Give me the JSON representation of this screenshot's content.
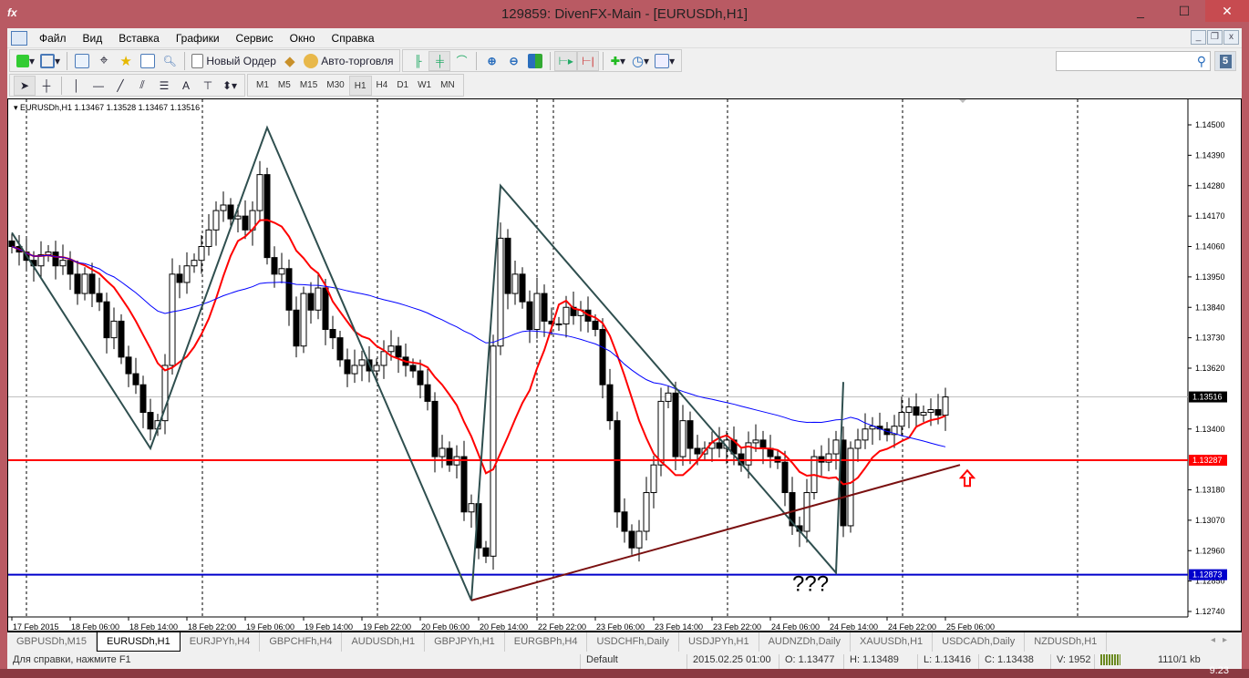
{
  "window": {
    "title": "129859: DivenFX-Main - [EURUSDh,H1]",
    "minimize": "_",
    "maximize": "☐",
    "close": "✕"
  },
  "menu": [
    "Файл",
    "Вид",
    "Вставка",
    "Графики",
    "Сервис",
    "Окно",
    "Справка"
  ],
  "toolbar": {
    "new_order": "Новый Ордер",
    "auto_trading": "Авто-торговля",
    "search_placeholder": "",
    "notifications": "5"
  },
  "drawing_tools": {
    "text_tool": "A"
  },
  "timeframes": [
    "M1",
    "M5",
    "M15",
    "M30",
    "H1",
    "H4",
    "D1",
    "W1",
    "MN"
  ],
  "active_timeframe": "H1",
  "chart_data": {
    "type": "candlestick",
    "legend": "EURUSDh,H1  1.13467 1.13528 1.13467 1.13516",
    "symbol": "EURUSDh",
    "timeframe": "H1",
    "ylim": [
      1.1268,
      1.1458
    ],
    "y_ticks": [
      "1.14500",
      "1.14390",
      "1.14280",
      "1.14170",
      "1.14060",
      "1.13950",
      "1.13840",
      "1.13730",
      "1.13620",
      "1.13400",
      "1.13180",
      "1.13070",
      "1.12960",
      "1.12850",
      "1.12740"
    ],
    "x_ticks": [
      "17 Feb 2015",
      "18 Feb 06:00",
      "18 Feb 14:00",
      "18 Feb 22:00",
      "19 Feb 06:00",
      "19 Feb 14:00",
      "19 Feb 22:00",
      "20 Feb 06:00",
      "20 Feb 14:00",
      "22 Feb 22:00",
      "23 Feb 06:00",
      "23 Feb 14:00",
      "23 Feb 22:00",
      "24 Feb 06:00",
      "24 Feb 14:00",
      "24 Feb 22:00",
      "25 Feb 06:00"
    ],
    "closes": [
      1.1406,
      1.1404,
      1.1401,
      1.1399,
      1.1403,
      1.1404,
      1.1399,
      1.1401,
      1.1396,
      1.1389,
      1.1396,
      1.1389,
      1.1386,
      1.1373,
      1.1379,
      1.1366,
      1.136,
      1.1356,
      1.1346,
      1.134,
      1.1343,
      1.1363,
      1.1396,
      1.1393,
      1.1399,
      1.1401,
      1.1406,
      1.1412,
      1.1419,
      1.1421,
      1.1416,
      1.1417,
      1.1412,
      1.1419,
      1.1432,
      1.1402,
      1.1396,
      1.1398,
      1.1383,
      1.137,
      1.1389,
      1.1383,
      1.1391,
      1.1376,
      1.1373,
      1.1365,
      1.136,
      1.1363,
      1.1365,
      1.1361,
      1.1363,
      1.1368,
      1.137,
      1.1366,
      1.1363,
      1.1361,
      1.1356,
      1.135,
      1.133,
      1.1333,
      1.1327,
      1.133,
      1.131,
      1.1313,
      1.1297,
      1.1294,
      1.137,
      1.1409,
      1.1389,
      1.1396,
      1.1386,
      1.1376,
      1.1389,
      1.1379,
      1.1378,
      1.1378,
      1.1384,
      1.1381,
      1.1383,
      1.1379,
      1.1376,
      1.1356,
      1.1343,
      1.131,
      1.1303,
      1.1297,
      1.1303,
      1.1317,
      1.1327,
      1.135,
      1.1353,
      1.133,
      1.1343,
      1.1333,
      1.1331,
      1.1333,
      1.1335,
      1.1333,
      1.1336,
      1.1331,
      1.1327,
      1.1335,
      1.1336,
      1.1333,
      1.133,
      1.1328,
      1.1317,
      1.1305,
      1.1303,
      1.1317,
      1.133,
      1.1328,
      1.1331,
      1.1336,
      1.1305,
      1.1333,
      1.1336,
      1.134,
      1.1341,
      1.134,
      1.1338,
      1.1341,
      1.1346,
      1.1348,
      1.1345,
      1.1346,
      1.1347,
      1.1345,
      1.13516
    ],
    "moving_averages": [
      {
        "color": "#ff0000",
        "period": 10
      },
      {
        "color": "#0000ff",
        "period": 50
      }
    ],
    "bid_line": {
      "price": "1.13516",
      "color": "#c0c0c0"
    },
    "horizontal_lines": [
      {
        "price": "1.13287",
        "color": "#ff0000"
      },
      {
        "price": "1.12873",
        "color": "#0000cc"
      }
    ],
    "zigzag": {
      "color": "#2f4f4f",
      "points": [
        [
          0,
          1.1411
        ],
        [
          19,
          1.1333
        ],
        [
          35,
          1.1449
        ],
        [
          63,
          1.1278
        ],
        [
          67,
          1.1428
        ],
        [
          113,
          1.1288
        ],
        [
          114,
          1.1357
        ]
      ]
    },
    "trendline": {
      "color": "#7a1010",
      "points": [
        [
          63,
          1.1278
        ],
        [
          130,
          1.1327
        ]
      ]
    },
    "arrow": {
      "direction": "up",
      "color": "#ff0000",
      "bar": 131,
      "price": 1.1325
    },
    "annotation": {
      "text": "???",
      "bar": 107,
      "price": 1.1283
    }
  },
  "tabs": [
    "GBPUSDh,M15",
    "EURUSDh,H1",
    "EURJPYh,H4",
    "GBPCHFh,H4",
    "AUDUSDh,H1",
    "GBPJPYh,H1",
    "EURGBPh,H4",
    "USDCHFh,Daily",
    "USDJPYh,H1",
    "AUDNZDh,Daily",
    "XAUUSDh,H1",
    "USDCADh,Daily",
    "NZDUSDh,H1"
  ],
  "active_tab": "EURUSDh,H1",
  "status": {
    "help": "Для справки, нажмите F1",
    "profile": "Default",
    "time": "2015.02.25 01:00",
    "open": "O: 1.13477",
    "high": "H: 1.13489",
    "low": "L: 1.13416",
    "close": "C: 1.13438",
    "volume": "V: 1952",
    "traffic": "1110/1 kb"
  },
  "clock": "9:23"
}
